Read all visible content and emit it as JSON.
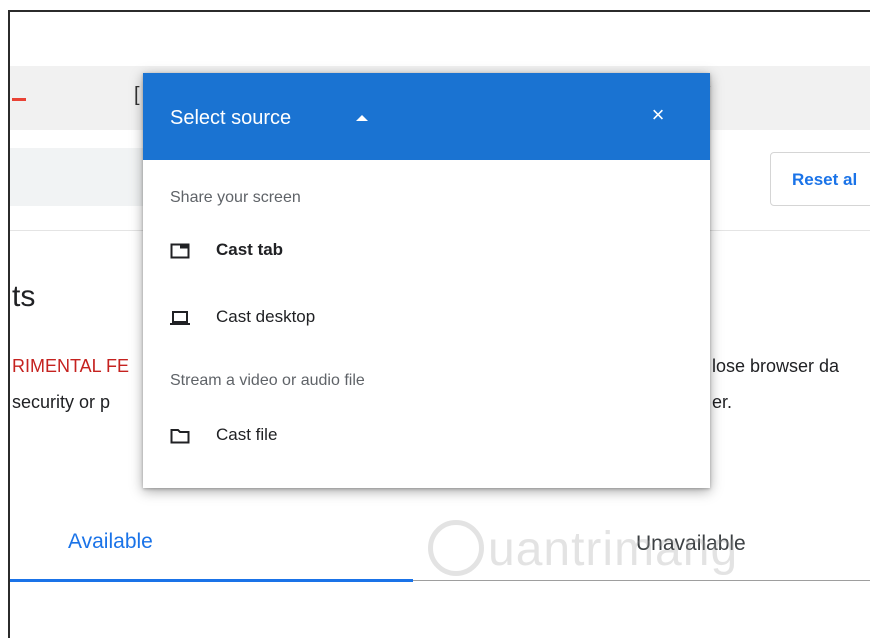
{
  "background": {
    "reset_button": "Reset al",
    "heading_fragment": "ts",
    "warning_fragment": "RIMENTAL FE",
    "note_fragment": "security or p",
    "warning_right_fragment": "lose browser da",
    "note_right_fragment": "er.",
    "toolbar_fragment": "[",
    "toolbar_fragment_right": "´",
    "tabs": {
      "available": "Available",
      "unavailable": "Unavailable"
    },
    "watermark": "uantrimang"
  },
  "dialog": {
    "title": "Select source",
    "close_label": "×",
    "sections": [
      {
        "label": "Share your screen"
      },
      {
        "label": "Stream a video or audio file"
      }
    ],
    "items": [
      {
        "label": "Cast tab",
        "icon": "tab-icon"
      },
      {
        "label": "Cast desktop",
        "icon": "laptop-icon"
      },
      {
        "label": "Cast file",
        "icon": "folder-icon"
      }
    ]
  },
  "colors": {
    "header": "#1a73d2",
    "accent": "#1a73e8",
    "warning": "#c5221f"
  }
}
